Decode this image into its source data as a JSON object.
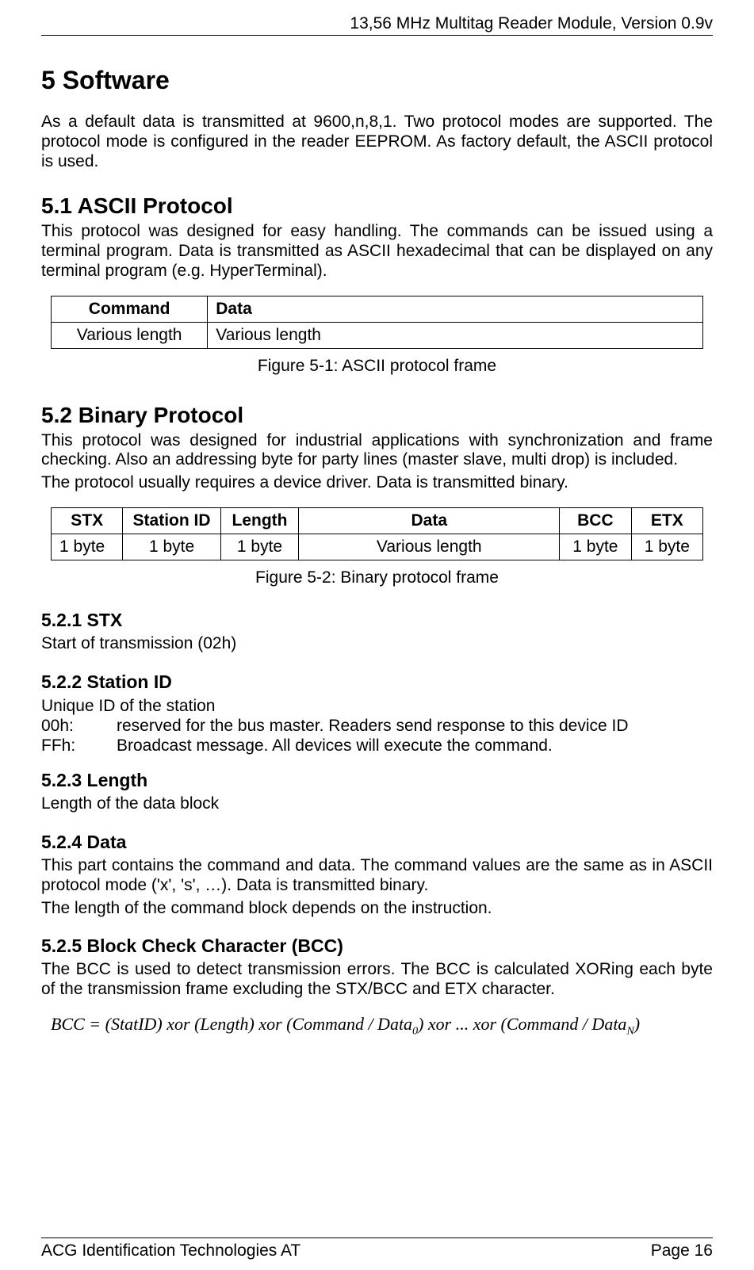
{
  "header": "13,56 MHz Multitag Reader Module, Version 0.9v",
  "h1": "5 Software",
  "intro": "As a default data is transmitted at 9600,n,8,1. Two protocol modes are supported. The protocol mode is configured in the reader EEPROM. As factory default, the ASCII protocol is used.",
  "s51": {
    "title": "5.1 ASCII Protocol",
    "body": "This protocol was designed for easy handling. The commands can be issued using a terminal program. Data is transmitted as ASCII hexadecimal that can be displayed on any terminal program (e.g. HyperTerminal).",
    "th1": "Command",
    "th2": "Data",
    "td1": "Various length",
    "td2": "Various length",
    "caption": "Figure 5-1: ASCII protocol frame"
  },
  "s52": {
    "title": "5.2 Binary Protocol",
    "body1": "This protocol was designed for industrial applications with synchronization and frame checking. Also an addressing byte for party lines (master slave, multi drop) is included.",
    "body2": "The protocol usually requires a device driver. Data is transmitted binary.",
    "th": [
      "STX",
      "Station ID",
      "Length",
      "Data",
      "BCC",
      "ETX"
    ],
    "td": [
      "1 byte",
      "1 byte",
      "1 byte",
      "Various length",
      "1 byte",
      "1 byte"
    ],
    "caption": "Figure 5-2: Binary protocol frame"
  },
  "s521": {
    "title": "5.2.1 STX",
    "body": "Start of transmission (02h)"
  },
  "s522": {
    "title": "5.2.2 Station ID",
    "line1": "Unique ID of the station",
    "k1": "00h:",
    "v1": "reserved for the bus master. Readers send response to this device ID",
    "k2": "FFh:",
    "v2": "Broadcast message. All devices will execute the command."
  },
  "s523": {
    "title": "5.2.3 Length",
    "body": "Length of the data block"
  },
  "s524": {
    "title": "5.2.4 Data",
    "body1": "This part contains the command and data. The command values are the same as in ASCII protocol mode ('x', 's', …). Data is transmitted binary.",
    "body2": "The length of the command block depends on the instruction."
  },
  "s525": {
    "title": "5.2.5 Block Check Character (BCC)",
    "body": "The BCC is used to detect transmission errors. The BCC is calculated XORing each byte of the transmission frame excluding the STX/BCC and ETX character."
  },
  "formula": {
    "lhs": "BCC",
    "eq": "=",
    "p1": "(StatID)",
    "xor": "xor",
    "p2": "(Length)",
    "p3a": "(Command / Data",
    "sub0": "0",
    "p3b": ")",
    "dots": "...",
    "p4a": "(Command / Data",
    "subN": "N",
    "p4b": ")"
  },
  "footer": {
    "left": "ACG Identification Technologies AT",
    "right": "Page 16"
  }
}
